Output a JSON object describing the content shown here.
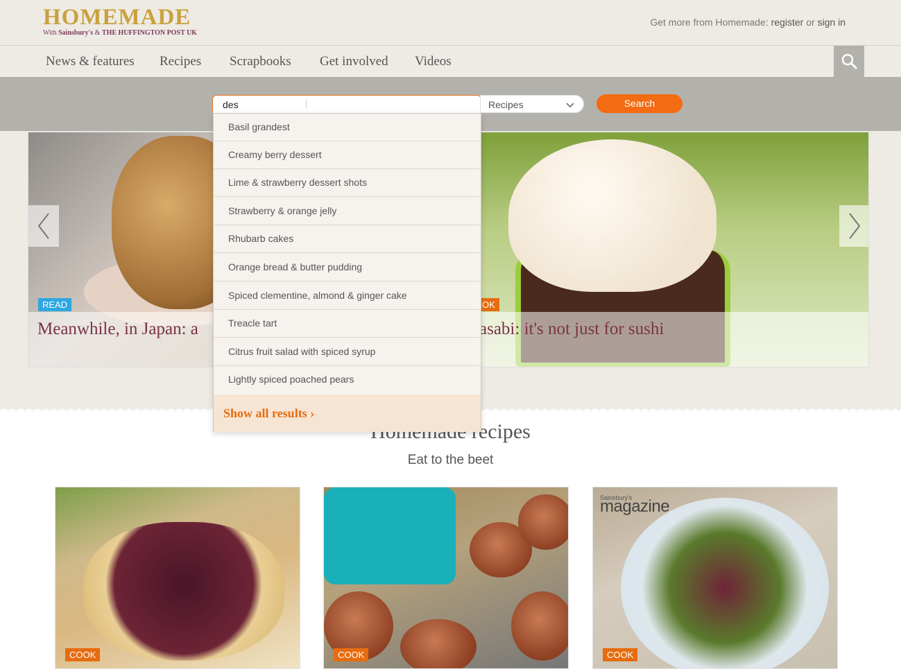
{
  "header": {
    "logo_main": "HOMEMADE",
    "logo_sub_prefix": "With",
    "logo_sub_brand1": "Sainsbury's",
    "logo_sub_amp": "&",
    "logo_sub_brand2": "THE HUFFINGTON POST UK",
    "account_prefix": "Get more from Homemade:",
    "register_link": "register",
    "or_text": "or",
    "signin_link": "sign in"
  },
  "nav": {
    "items": [
      {
        "label": "News & features"
      },
      {
        "label": "Recipes"
      },
      {
        "label": "Scrapbooks"
      },
      {
        "label": "Get involved"
      },
      {
        "label": "Videos"
      }
    ]
  },
  "search": {
    "value": "des",
    "scope_selected": "Recipes",
    "button_label": "Search",
    "suggestions": [
      "Basil grandest",
      "Creamy berry dessert",
      "Lime & strawberry dessert shots",
      "Strawberry & orange jelly",
      "Rhubarb cakes",
      "Orange bread & butter pudding",
      "Spiced clementine, almond & ginger cake",
      "Treacle tart",
      "Citrus fruit salad with spiced syrup",
      "Lightly spiced poached pears"
    ],
    "show_all_label": "Show all results",
    "show_all_chevron": "›"
  },
  "hero": {
    "left_tag": "READ",
    "left_caption": "Meanwhile, in Japan: a",
    "right_tag": "OK",
    "right_caption": "asabi: it's not just for sushi"
  },
  "section": {
    "title": "Homemade recipes",
    "subtitle": "Eat to the beet"
  },
  "cards": [
    {
      "tag": "COOK"
    },
    {
      "tag": "COOK"
    },
    {
      "tag": "COOK",
      "logo_small": "Sainsbury's",
      "logo_big": "magazine"
    }
  ],
  "colors": {
    "accent": "#f36b12",
    "read_tag": "#2ea6e0",
    "cook_tag": "#e66c0f",
    "caption": "#7a3347",
    "background": "#eeebe5"
  },
  "icons": {
    "search": "search-icon",
    "chevron_down": "chevron-down-icon",
    "prev": "chevron-left-icon",
    "next": "chevron-right-icon"
  }
}
